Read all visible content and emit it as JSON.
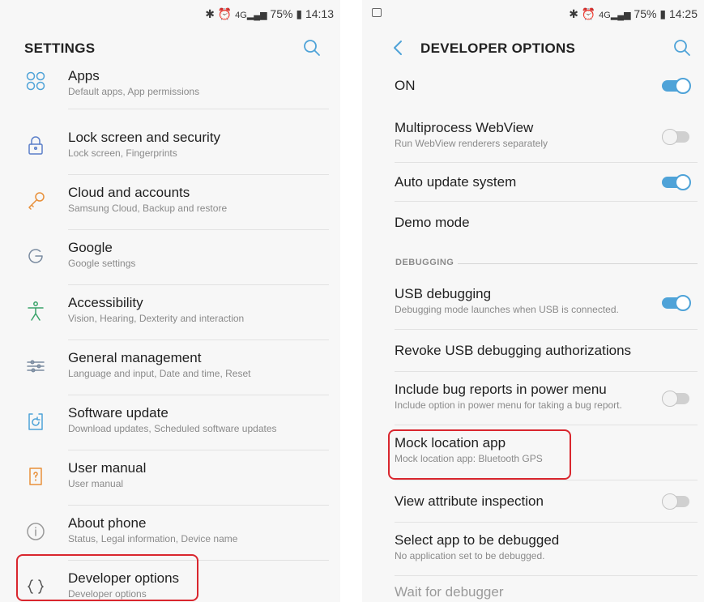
{
  "left": {
    "status": {
      "battery_percent": "75%",
      "time": "14:13"
    },
    "header": {
      "title": "SETTINGS"
    },
    "items": [
      {
        "title": "Apps",
        "subtitle": "Default apps, App permissions",
        "icon": "apps-icon"
      },
      {
        "title": "Lock screen and security",
        "subtitle": "Lock screen, Fingerprints",
        "icon": "lock-icon"
      },
      {
        "title": "Cloud and accounts",
        "subtitle": "Samsung Cloud, Backup and restore",
        "icon": "key-icon"
      },
      {
        "title": "Google",
        "subtitle": "Google settings",
        "icon": "google-icon"
      },
      {
        "title": "Accessibility",
        "subtitle": "Vision, Hearing, Dexterity and interaction",
        "icon": "accessibility-icon"
      },
      {
        "title": "General management",
        "subtitle": "Language and input, Date and time, Reset",
        "icon": "sliders-icon"
      },
      {
        "title": "Software update",
        "subtitle": "Download updates, Scheduled software updates",
        "icon": "update-icon"
      },
      {
        "title": "User manual",
        "subtitle": "User manual",
        "icon": "manual-icon"
      },
      {
        "title": "About phone",
        "subtitle": "Status, Legal information, Device name",
        "icon": "info-icon"
      },
      {
        "title": "Developer options",
        "subtitle": "Developer options",
        "icon": "braces-icon"
      }
    ]
  },
  "right": {
    "status": {
      "battery_percent": "75%",
      "time": "14:25"
    },
    "header": {
      "title": "DEVELOPER OPTIONS"
    },
    "master": {
      "label": "ON",
      "enabled": true
    },
    "items_top": [
      {
        "title": "Multiprocess WebView",
        "subtitle": "Run WebView renderers separately",
        "toggle": false
      },
      {
        "title": "Auto update system",
        "subtitle": "",
        "toggle": true
      },
      {
        "title": "Demo mode",
        "subtitle": ""
      }
    ],
    "section": "DEBUGGING",
    "items_debug": [
      {
        "title": "USB debugging",
        "subtitle": "Debugging mode launches when USB is connected.",
        "toggle": true
      },
      {
        "title": "Revoke USB debugging authorizations",
        "subtitle": ""
      },
      {
        "title": "Include bug reports in power menu",
        "subtitle": "Include option in power menu for taking a bug report.",
        "toggle": false
      },
      {
        "title": "Mock location app",
        "subtitle": "Mock location app: Bluetooth GPS"
      },
      {
        "title": "View attribute inspection",
        "subtitle": "",
        "toggle": false
      },
      {
        "title": "Select app to be debugged",
        "subtitle": "No application set to be debugged."
      },
      {
        "title": "Wait for debugger",
        "subtitle": ""
      }
    ]
  },
  "colors": {
    "accent": "#4fa3d8",
    "highlight": "#d9262e"
  }
}
